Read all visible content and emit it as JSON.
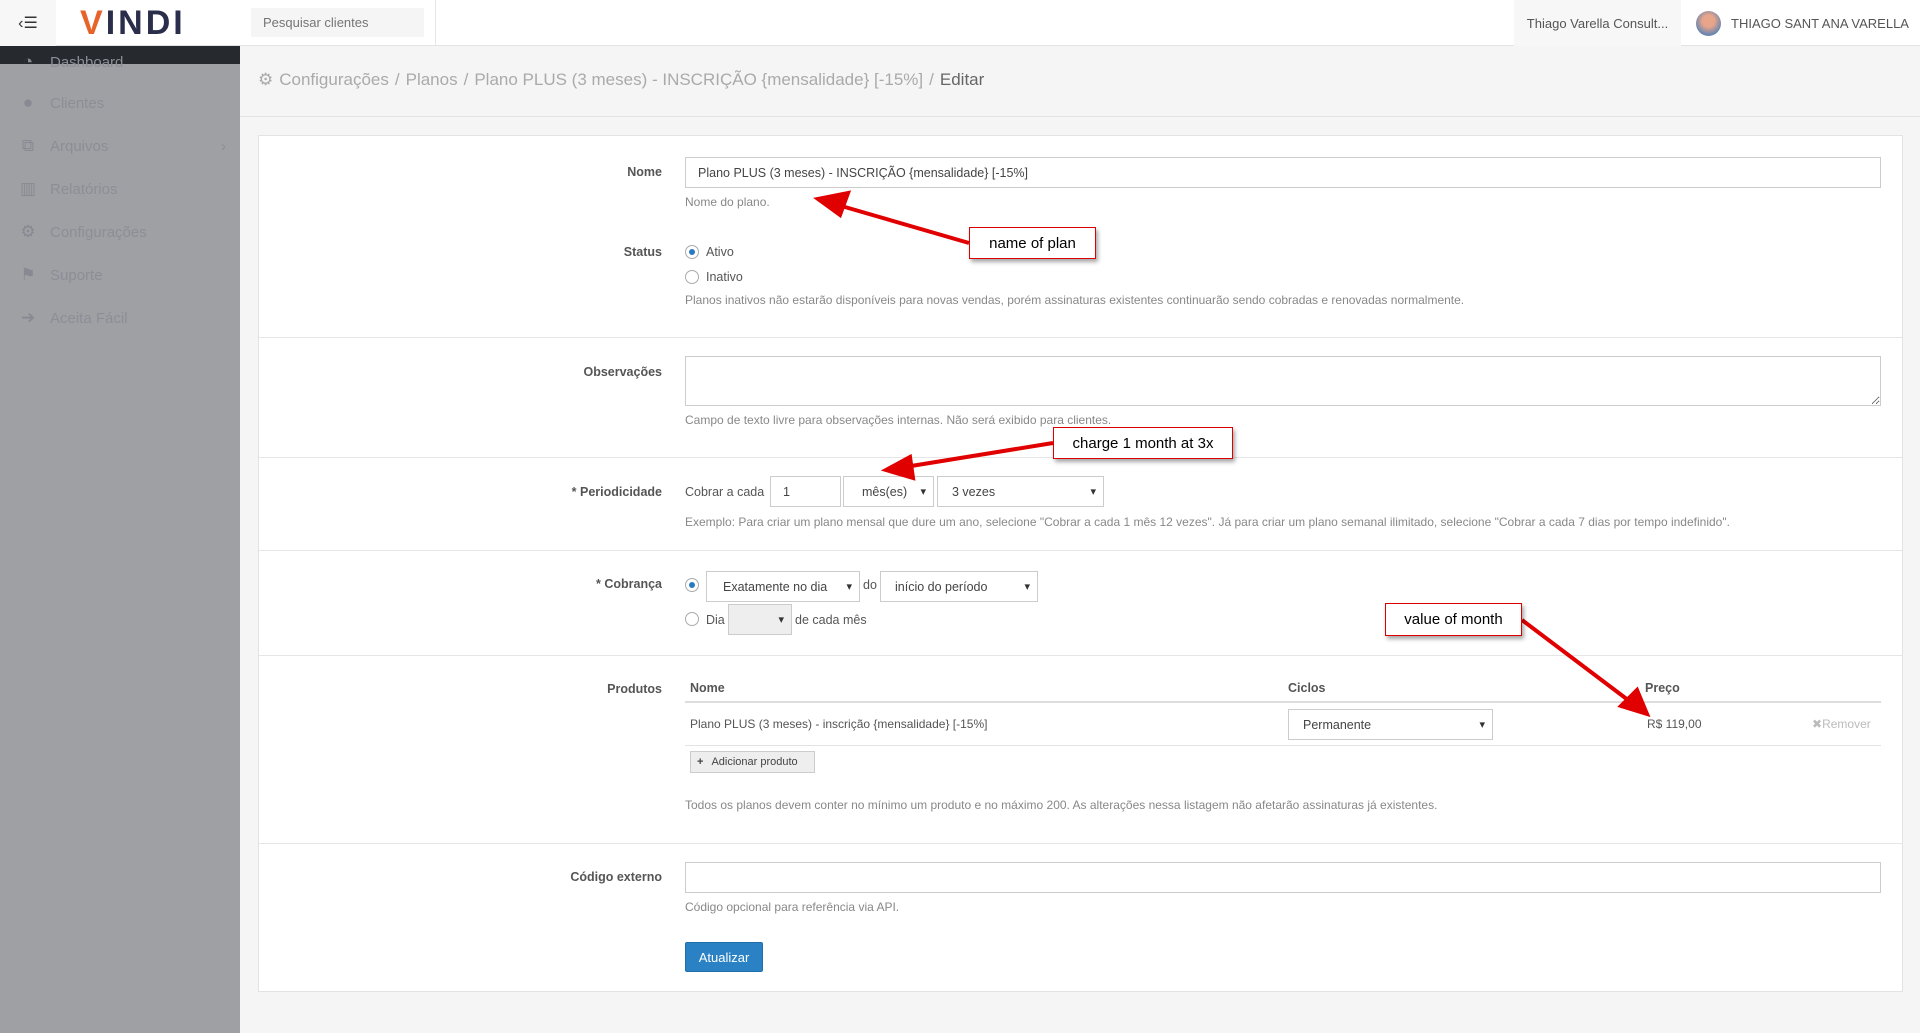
{
  "header": {
    "logo": "VINDI",
    "search_placeholder": "Pesquisar clientes",
    "company": "Thiago Varella Consult...",
    "user": "THIAGO SANT ANA VARELLA"
  },
  "sidebar": {
    "items": [
      {
        "label": "Dashboard",
        "icon": "dashboard-icon",
        "glyph": "◔"
      },
      {
        "label": "Clientes",
        "icon": "user-icon",
        "glyph": "●"
      },
      {
        "label": "Arquivos",
        "icon": "files-icon",
        "glyph": "⧉"
      },
      {
        "label": "Relatórios",
        "icon": "bar-chart-icon",
        "glyph": "▥"
      },
      {
        "label": "Configurações",
        "icon": "gears-icon",
        "glyph": "⚙"
      },
      {
        "label": "Suporte",
        "icon": "flag-icon",
        "glyph": "⚑"
      },
      {
        "label": "Aceita Fácil",
        "icon": "sign-in-icon",
        "glyph": "➔"
      }
    ]
  },
  "breadcrumb": {
    "items": [
      "Configurações",
      "Planos",
      "Plano PLUS (3 meses) - INSCRIÇÃO {mensalidade} [-15%]"
    ],
    "current": "Editar",
    "sep": "/"
  },
  "form": {
    "nome": {
      "label": "Nome",
      "value": "Plano PLUS (3 meses) - INSCRIÇÃO {mensalidade} [-15%]",
      "help": "Nome do plano."
    },
    "status": {
      "label": "Status",
      "options": [
        "Ativo",
        "Inativo"
      ],
      "selected": "Ativo",
      "help": "Planos inativos não estarão disponíveis para novas vendas, porém assinaturas existentes continuarão sendo cobradas e renovadas normalmente."
    },
    "observacoes": {
      "label": "Observações",
      "value": "",
      "help": "Campo de texto livre para observações internas. Não será exibido para clientes."
    },
    "periodicidade": {
      "label": "Periodicidade",
      "required": "*",
      "prefix": "Cobrar a cada",
      "interval": "1",
      "unit": "mês(es)",
      "count": "3 vezes",
      "help": "Exemplo: Para criar um plano mensal que dure um ano, selecione \"Cobrar a cada 1 mês 12 vezes\". Já para criar um plano semanal ilimitado, selecione \"Cobrar a cada 7 dias por tempo indefinido\"."
    },
    "cobranca": {
      "label": "Cobrança",
      "required": "*",
      "mode": "Exatamente no dia",
      "do": "do",
      "period": "início do período",
      "dia_label": "Dia",
      "dia_value": "",
      "dia_suffix": "de cada mês"
    },
    "produtos": {
      "label": "Produtos",
      "columns": [
        "Nome",
        "Ciclos",
        "Preço"
      ],
      "rows": [
        {
          "nome": "Plano PLUS (3 meses) - inscrição {mensalidade} [-15%]",
          "ciclos": "Permanente",
          "preco": "R$ 119,00",
          "remove": "Remover"
        }
      ],
      "add_label": "Adicionar produto",
      "help": "Todos os planos devem conter no mínimo um produto e no máximo 200. As alterações nessa listagem não afetarão assinaturas já existentes."
    },
    "codigo": {
      "label": "Código externo",
      "value": "",
      "help": "Código opcional para referência via API."
    },
    "submit": "Atualizar"
  },
  "annotations": [
    "name of plan",
    "charge 1 month at 3x",
    "value of month"
  ],
  "colors": {
    "accent": "#2a82c4",
    "annotation": "#e00000"
  }
}
